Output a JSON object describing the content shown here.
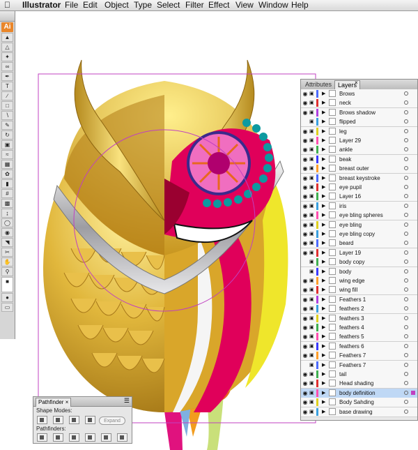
{
  "menubar": {
    "apple": "",
    "items": [
      "Illustrator",
      "File",
      "Edit",
      "Object",
      "Type",
      "Select",
      "Filter",
      "Effect",
      "View",
      "Window",
      "Help"
    ]
  },
  "tools": {
    "logo": "Ai",
    "items": [
      "selection",
      "direct-selection",
      "magic-wand",
      "lasso",
      "pen",
      "type",
      "line",
      "rectangle",
      "paintbrush",
      "pencil",
      "rotate",
      "scale",
      "warp",
      "free-transform",
      "symbol-sprayer",
      "graph",
      "mesh",
      "gradient",
      "eyedropper",
      "blend",
      "live-paint",
      "slice",
      "scissors",
      "hand",
      "zoom",
      "fill-stroke",
      "color-mode",
      "screen-mode"
    ]
  },
  "layers_panel": {
    "tabs": [
      "Attributes",
      "Layers"
    ],
    "active_tab": "Layers",
    "layers": [
      {
        "name": "Brows",
        "color": "#4c6cff",
        "visible": true
      },
      {
        "name": "neck",
        "color": "#e03030",
        "visible": true
      },
      {
        "name": "Brows shadow",
        "color": "#b040e0",
        "visible": true
      },
      {
        "name": "flipped",
        "color": "#3aa0e0",
        "visible": false
      },
      {
        "name": "leg",
        "color": "#e0d020",
        "visible": true
      },
      {
        "name": "Layer 29",
        "color": "#ff4fb0",
        "visible": true
      },
      {
        "name": "ankle",
        "color": "#40b050",
        "visible": true
      },
      {
        "name": "beak",
        "color": "#3a3aff",
        "visible": true
      },
      {
        "name": "breast outer",
        "color": "#ff9e2a",
        "visible": true
      },
      {
        "name": "breast keystroke",
        "color": "#4c6cff",
        "visible": true
      },
      {
        "name": "eye pupil",
        "color": "#e03030",
        "visible": true
      },
      {
        "name": "Layer 16",
        "color": "#40b050",
        "visible": true
      },
      {
        "name": "iris",
        "color": "#3aa0e0",
        "visible": true
      },
      {
        "name": "eye bling spheres",
        "color": "#ff4fb0",
        "visible": true
      },
      {
        "name": "eye bling",
        "color": "#e0d020",
        "visible": true
      },
      {
        "name": "eye bling copy",
        "color": "#3aa0e0",
        "visible": true
      },
      {
        "name": "beard",
        "color": "#4c6cff",
        "visible": true
      },
      {
        "name": "Layer 19",
        "color": "#e03030",
        "visible": true
      },
      {
        "name": "body copy",
        "color": "#40b050",
        "visible": false
      },
      {
        "name": "body",
        "color": "#3a3aff",
        "visible": false
      },
      {
        "name": "wing edge",
        "color": "#ff9e2a",
        "visible": true
      },
      {
        "name": "wing fill",
        "color": "#e03030",
        "visible": true
      },
      {
        "name": "Feathers 1",
        "color": "#b040e0",
        "visible": true
      },
      {
        "name": "feathers 2",
        "color": "#3aa0e0",
        "visible": true
      },
      {
        "name": "feathers 3",
        "color": "#e0d020",
        "visible": true
      },
      {
        "name": "feathers 4",
        "color": "#40b050",
        "visible": true
      },
      {
        "name": "feathers 5",
        "color": "#ff4fb0",
        "visible": true
      },
      {
        "name": "feathers 6",
        "color": "#3a3aff",
        "visible": true
      },
      {
        "name": "Feathers 7",
        "color": "#ff9e2a",
        "visible": true
      },
      {
        "name": "Feathers 7",
        "color": "#4c6cff",
        "visible": false
      },
      {
        "name": "tail",
        "color": "#40b050",
        "visible": true
      },
      {
        "name": "Head shading",
        "color": "#e03030",
        "visible": true
      },
      {
        "name": "body definition",
        "color": "#ff4fb0",
        "visible": true,
        "selected": true
      },
      {
        "name": "Body Sahding",
        "color": "#e0d020",
        "visible": true
      },
      {
        "name": "base drawing",
        "color": "#3aa0e0",
        "visible": true
      }
    ]
  },
  "pathfinder": {
    "tab": "Pathfinder",
    "shape_modes_label": "Shape Modes:",
    "pathfinders_label": "Pathfinders:",
    "expand_label": "Expand"
  },
  "artwork": {
    "description_colors": {
      "gold": "#d4a626",
      "dark_gold": "#a97815",
      "magenta": "#e0005a",
      "yellow": "#efe62b",
      "teal": "#0d9aa0",
      "pink": "#f07cc0",
      "silver": "#c9c9cc"
    }
  }
}
